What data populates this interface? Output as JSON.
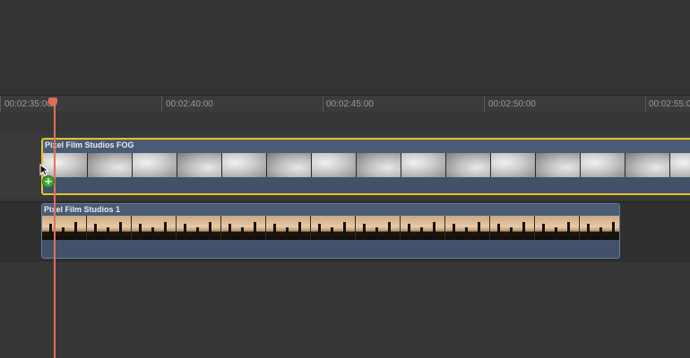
{
  "ruler": {
    "timecodes": [
      "00:02:35:00",
      "00:02:40:00",
      "00:02:45:00",
      "00:02:50:00",
      "00:02:55:00"
    ]
  },
  "clips": {
    "fog": {
      "title": "Pixel Film Studios FOG"
    },
    "studios1": {
      "title": "Pixel Film Studios 1"
    }
  },
  "icons": {
    "add": "+",
    "playhead": "playhead-icon",
    "cursor": "pointer-cursor-icon"
  },
  "colors": {
    "selection": "#e6c229",
    "playhead": "#e0705a",
    "clip_fill": "#4a5b74",
    "add_badge": "#3fa63a"
  }
}
